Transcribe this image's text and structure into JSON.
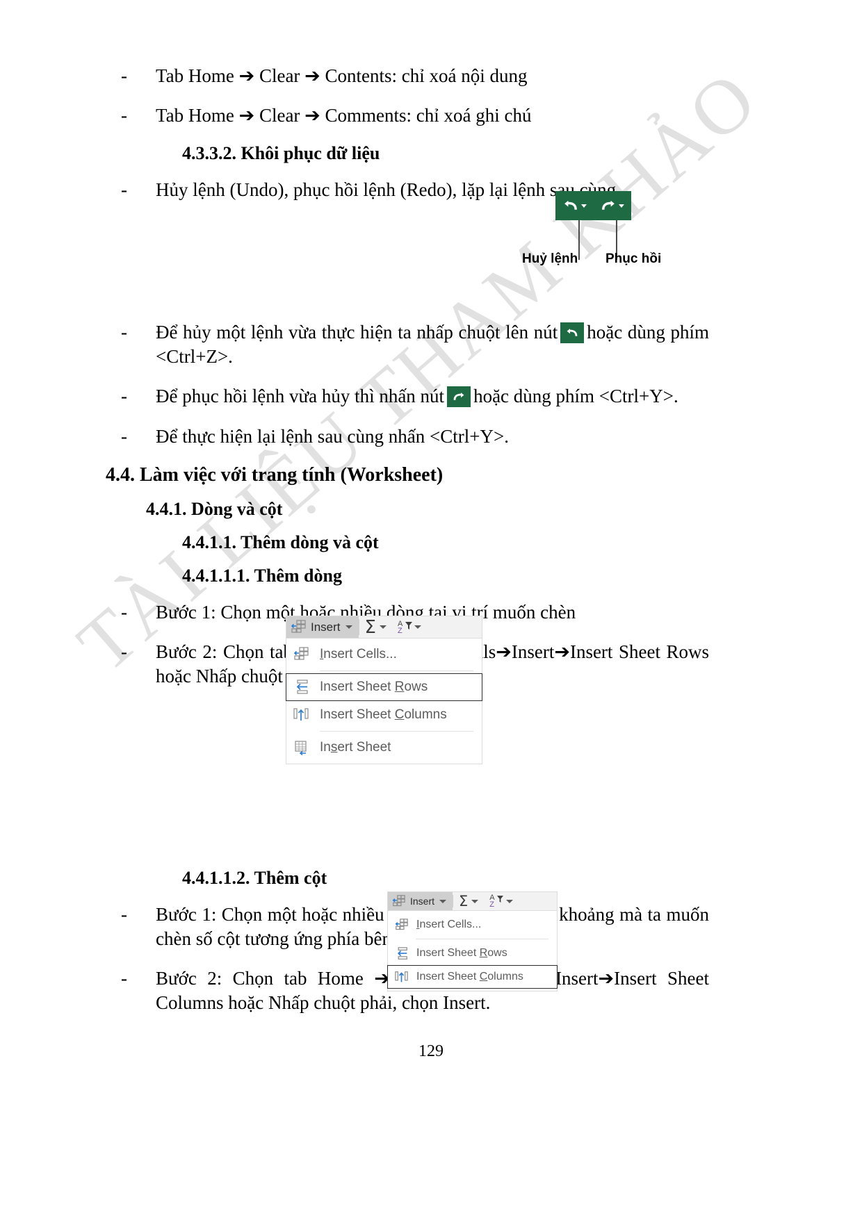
{
  "watermark": {
    "text": "TÀI LIỆU THAM KHẢO"
  },
  "page_number": "129",
  "body": {
    "bullets_top": [
      {
        "dash": "-",
        "text": "Tab Home ➔ Clear ➔ Contents: chỉ xoá nội dung"
      },
      {
        "dash": "-",
        "text": "Tab Home ➔ Clear ➔ Comments: chỉ xoá ghi chú"
      }
    ],
    "heading_4332": "4.3.3.2. Khôi phục dữ liệu",
    "bullet_undo_redo": {
      "dash": "-",
      "text": "Hủy lệnh (Undo), phục hồi lệnh (Redo), lặp lại lệnh sau cùng"
    },
    "bullet_undo": {
      "dash": "-",
      "part1": "Để hủy một lệnh vừa thực hiện ta nhấp chuột lên nút",
      "part2": "hoặc dùng phím <Ctrl+Z>."
    },
    "bullet_redo": {
      "dash": "-",
      "part1": "Để phục hồi lệnh vừa hủy thì nhấn nút",
      "part2": "hoặc dùng phím <Ctrl+Y>."
    },
    "bullet_repeat": {
      "dash": "-",
      "text": "Để thực hiện lại lệnh sau cùng nhấn <Ctrl+Y>."
    },
    "heading_44": "4.4. Làm việc với trang tính (Worksheet)",
    "heading_441": "4.4.1. Dòng và cột",
    "heading_4411": "4.4.1.1. Thêm dòng và cột",
    "heading_44111": "4.4.1.1.1. Thêm dòng",
    "row_step1": {
      "dash": "-",
      "text": "Bước 1: Chọn một hoặc nhiều dòng tại vị trí muốn chèn"
    },
    "row_step2": {
      "dash": "-",
      "text": "Bước 2: Chọn tab Home➔ chọn nhóm Cells➔Insert➔Insert Sheet Rows hoặc Nhấp chuột phải, chọn Insert."
    },
    "heading_44112": "4.4.1.1.2. Thêm cột",
    "col_step1": {
      "dash": "-",
      "text": "Bước 1: Chọn một hoặc nhiều cột liên tục hoặc cách khoảng mà ta muốn chèn số cột tương ứng phía bên trái các cột này."
    },
    "col_step2": {
      "dash": "-",
      "text": "Bước 2: Chọn tab Home ➔ chọn nhóm Cells➔Insert➔Insert Sheet Columns hoặc Nhấp chuột phải, chọn Insert."
    }
  },
  "quick_access_toolbar": {
    "background": "#1e6b43",
    "undo_icon": "undo-arrow-icon",
    "redo_icon": "redo-arrow-icon",
    "label_undo": "Huỷ lệnh",
    "label_redo": "Phục hồi"
  },
  "insert_menu_large": {
    "ribbon": {
      "insert_label": "Insert",
      "insert_icon": "insert-cells-icon",
      "dropdown_icon": "chevron-down-icon",
      "autosum_icon": "sigma-icon",
      "sort_filter_icon": "sort-az-filter-icon"
    },
    "items": [
      {
        "label": "Insert Cells...",
        "accel": "I",
        "icon": "insert-cells-icon",
        "selected": false
      },
      {
        "label": "Insert Sheet Rows",
        "accel": "R",
        "icon": "insert-sheet-rows-icon",
        "selected": true
      },
      {
        "label": "Insert Sheet Columns",
        "accel": "C",
        "icon": "insert-sheet-columns-icon",
        "selected": false
      },
      {
        "label": "Insert Sheet",
        "accel": "S",
        "icon": "insert-sheet-icon",
        "selected": false
      }
    ]
  },
  "insert_menu_small": {
    "ribbon": {
      "insert_label": "Insert",
      "insert_icon": "insert-cells-icon",
      "dropdown_icon": "chevron-down-icon",
      "autosum_icon": "sigma-icon",
      "sort_filter_icon": "sort-az-filter-icon"
    },
    "items": [
      {
        "label": "Insert Cells...",
        "accel": "I",
        "icon": "insert-cells-icon",
        "selected": false
      },
      {
        "label": "Insert Sheet Rows",
        "accel": "R",
        "icon": "insert-sheet-rows-icon",
        "selected": false
      },
      {
        "label": "Insert Sheet Columns",
        "accel": "C",
        "icon": "insert-sheet-columns-icon",
        "selected": true
      }
    ]
  }
}
